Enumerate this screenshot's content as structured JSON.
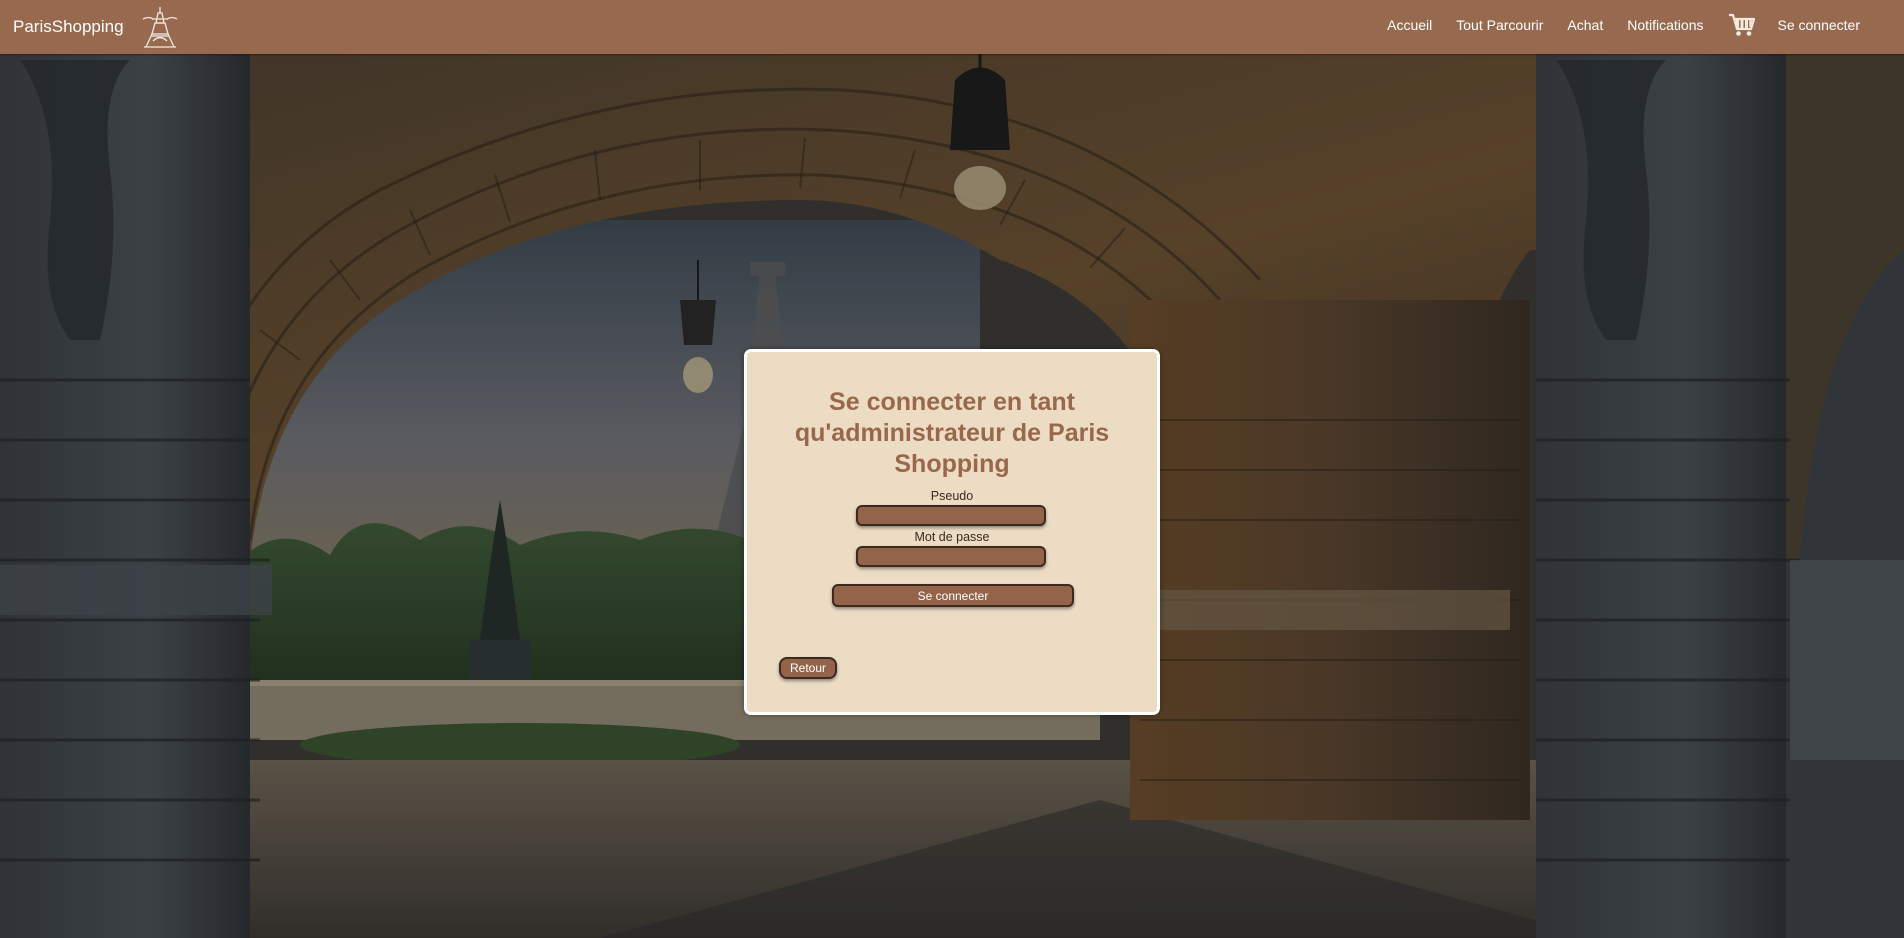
{
  "navbar": {
    "brand": "ParisShopping",
    "brand_logo_icon": "eiffel-tower-icon",
    "links": [
      "Accueil",
      "Tout Parcourir",
      "Achat",
      "Notifications"
    ],
    "cart_icon": "cart-icon",
    "login_link": "Se connecter",
    "background_color": "#976a50"
  },
  "login_card": {
    "title": "Se connecter en tant qu'administrateur de Paris Shopping",
    "pseudo_label": "Pseudo",
    "pseudo_value": "",
    "password_label": "Mot de passe",
    "password_value": "",
    "submit_label": "Se connecter",
    "back_label": "Retour",
    "background_color": "#ecdcc4",
    "accent_color": "#99684c"
  },
  "background": {
    "description_icon": "paris-bridge-arch-photo"
  }
}
